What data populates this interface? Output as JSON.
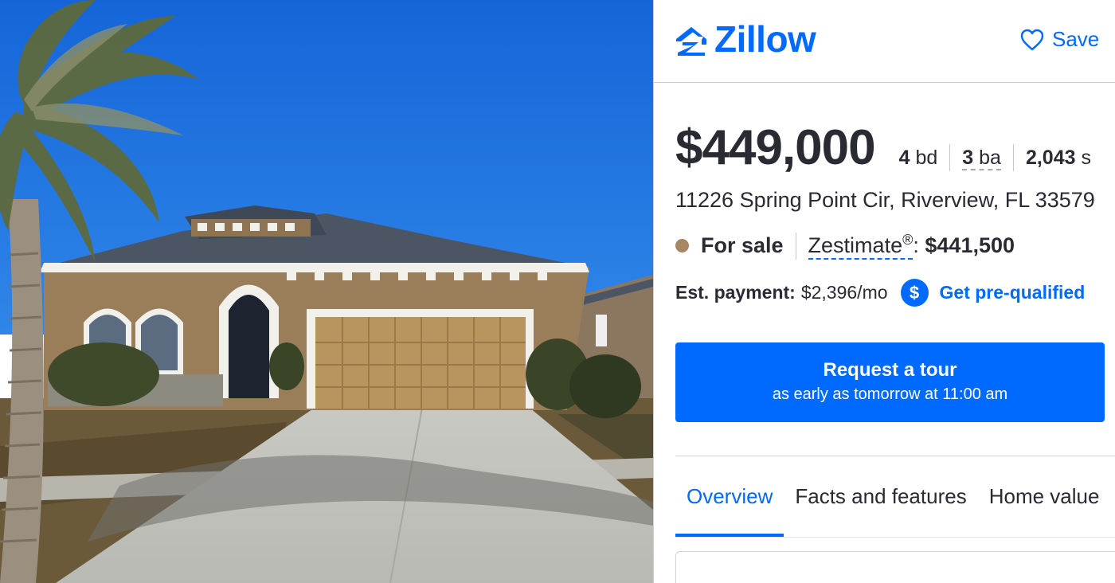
{
  "brand": {
    "name": "Zillow",
    "color": "#006aff",
    "logo_icon": "zillow-house-logo"
  },
  "header": {
    "save_label": "Save",
    "save_icon": "heart-outline-icon"
  },
  "listing": {
    "price": "$449,000",
    "beds": "4",
    "beds_unit": "bd",
    "baths": "3",
    "baths_unit": "ba",
    "sqft": "2,043",
    "sqft_unit": "s",
    "address": "11226 Spring Point Cir, Riverview, FL 33579",
    "status": "For sale",
    "status_color": "#a68665",
    "zestimate_label": "Zestimate",
    "zestimate_reg": "®",
    "zestimate_colon": ":",
    "zestimate_value": "$441,500",
    "payment_label": "Est. payment:",
    "payment_value": "$2,396/mo",
    "prequal_icon": "dollar-circle-icon",
    "prequal_label": "Get pre-qualified"
  },
  "tour": {
    "title": "Request a tour",
    "subtitle": "as early as tomorrow at 11:00 am"
  },
  "tabs": [
    {
      "label": "Overview",
      "active": true
    },
    {
      "label": "Facts and features",
      "active": false
    },
    {
      "label": "Home value",
      "active": false
    }
  ]
}
